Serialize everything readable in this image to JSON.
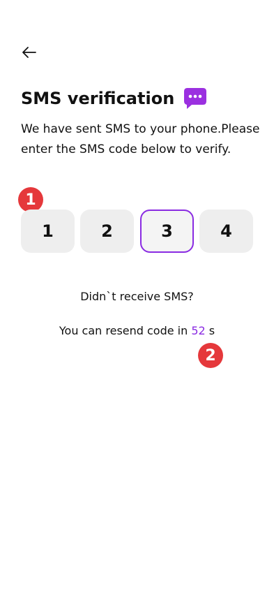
{
  "header": {
    "back_icon": "arrow-left-icon",
    "title": "SMS verification",
    "title_icon": "chat-bubble-dots-icon"
  },
  "subtitle": {
    "line1": "We have sent SMS to your phone.Please",
    "line2": "enter the SMS code below to verify."
  },
  "code": {
    "digits": [
      "1",
      "2",
      "3",
      "4"
    ],
    "active_index": 2
  },
  "resend": {
    "question": "Didn`t receive SMS?",
    "prefix": "You can resend code in ",
    "seconds": "52",
    "suffix": " s"
  },
  "markers": [
    "1",
    "2"
  ],
  "colors": {
    "accent": "#8a2be2",
    "chat_icon": "#9b30e0",
    "box_background": "#eeeeee",
    "marker": "#e5383b",
    "text": "#111111"
  }
}
